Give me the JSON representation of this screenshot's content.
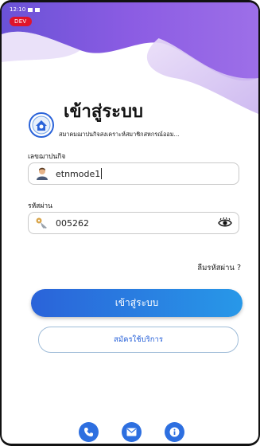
{
  "status": {
    "time": "12:10"
  },
  "badge": {
    "env": "DEV"
  },
  "header": {
    "title": "เข้าสู่ระบบ",
    "org_name": "สมาคมฌาปนกิจสงเคราะห์สมาชิกสหกรณ์ออม..."
  },
  "form": {
    "username_label": "เลขฌาปนกิจ",
    "username_value": "etnmode1",
    "password_label": "รหัสผ่าน",
    "password_value": "005262",
    "forgot_label": "ลืมรหัสผ่าน ?"
  },
  "actions": {
    "login_label": "เข้าสู่ระบบ",
    "register_label": "สมัครใช้บริการ"
  },
  "icons": {
    "user": "user-avatar-icon",
    "key": "key-icon",
    "eye": "eye-icon",
    "phone": "phone-icon",
    "mail": "mail-icon",
    "info": "info-icon"
  },
  "colors": {
    "primary": "#2a63d9",
    "dev_badge": "#e0142a",
    "hero_top": "#6a4bd1",
    "hero_mid": "#8a5ae0"
  }
}
